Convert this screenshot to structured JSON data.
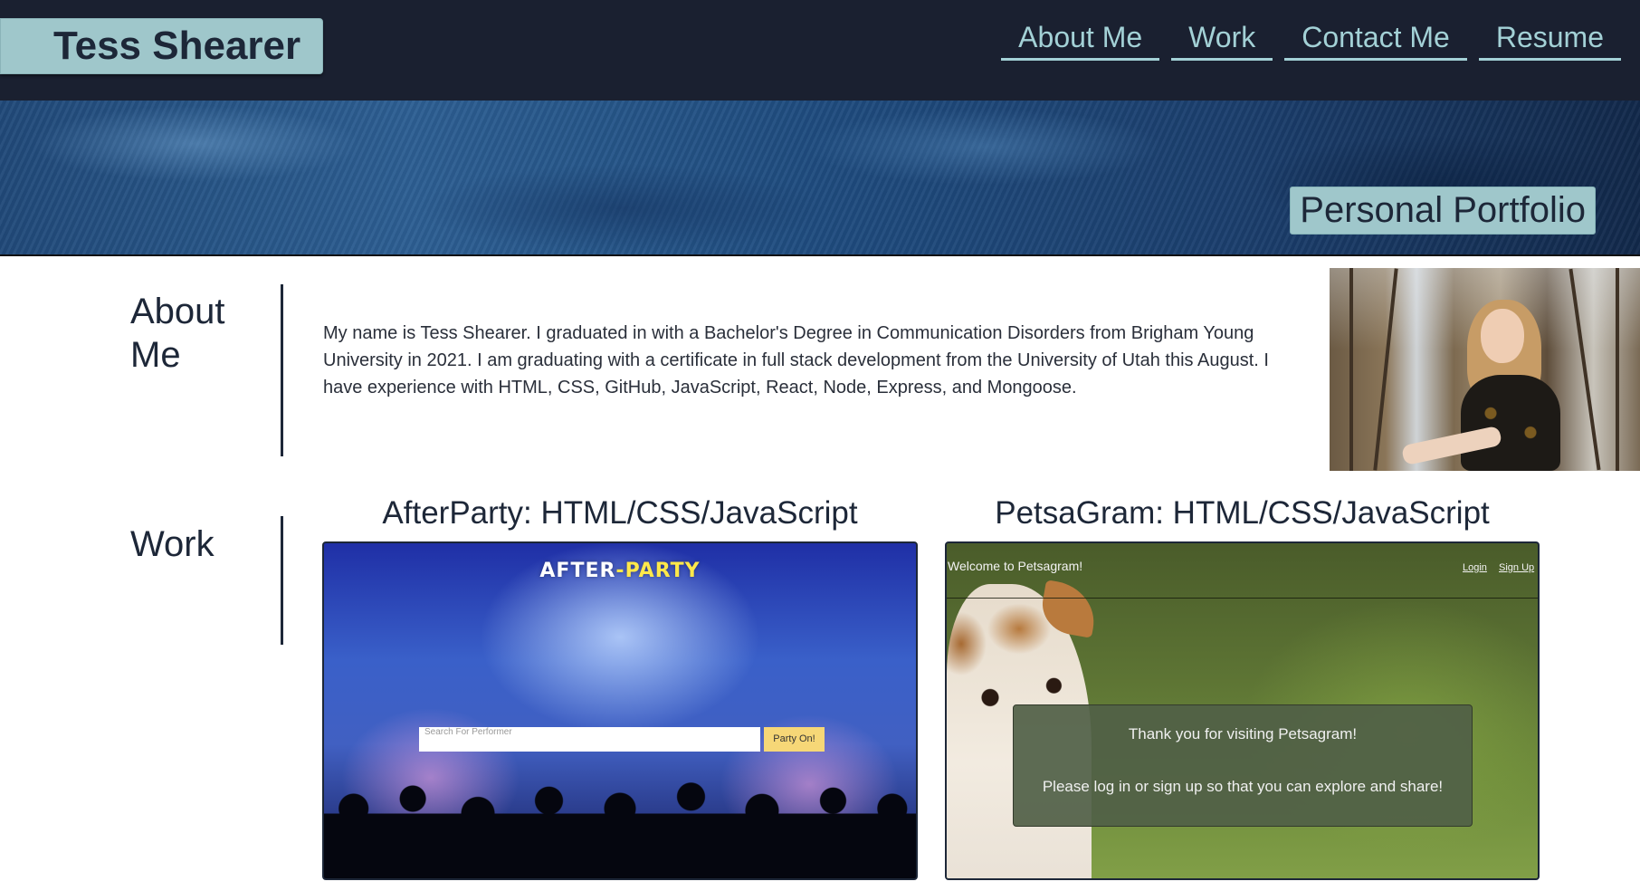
{
  "header": {
    "brand": "Tess Shearer",
    "nav": [
      "About Me",
      "Work",
      "Contact Me",
      "Resume"
    ]
  },
  "hero": {
    "badge": "Personal Portfolio"
  },
  "about": {
    "heading": "About Me",
    "text": "My name is Tess Shearer. I graduated in with a Bachelor's Degree in Communication Disorders from Brigham Young University in 2021. I am graduating with a certificate in full stack development from the University of Utah this August. I have experience with HTML, CSS, GitHub, JavaScript, React, Node, Express, and Mongoose."
  },
  "work": {
    "heading": "Work",
    "projects": [
      {
        "title": "AfterParty: HTML/CSS/JavaScript",
        "thumb": {
          "logo_left": "AFTER",
          "logo_dash": "-",
          "logo_right": "PARTY",
          "search_placeholder": "Search For Performer",
          "button": "Party On!"
        }
      },
      {
        "title": "PetsaGram: HTML/CSS/JavaScript",
        "thumb": {
          "site_title": "Welcome to Petsagram!",
          "login": "Login",
          "signup": "Sign Up",
          "modal_line1": "Thank you for visiting Petsagram!",
          "modal_line2": "Please log in or sign up so that you can explore and share!"
        }
      }
    ]
  },
  "colors": {
    "header_bg": "#1a2030",
    "accent": "#9fc7cb",
    "nav_text": "#a3d1d6",
    "heading_text": "#1d2738"
  }
}
